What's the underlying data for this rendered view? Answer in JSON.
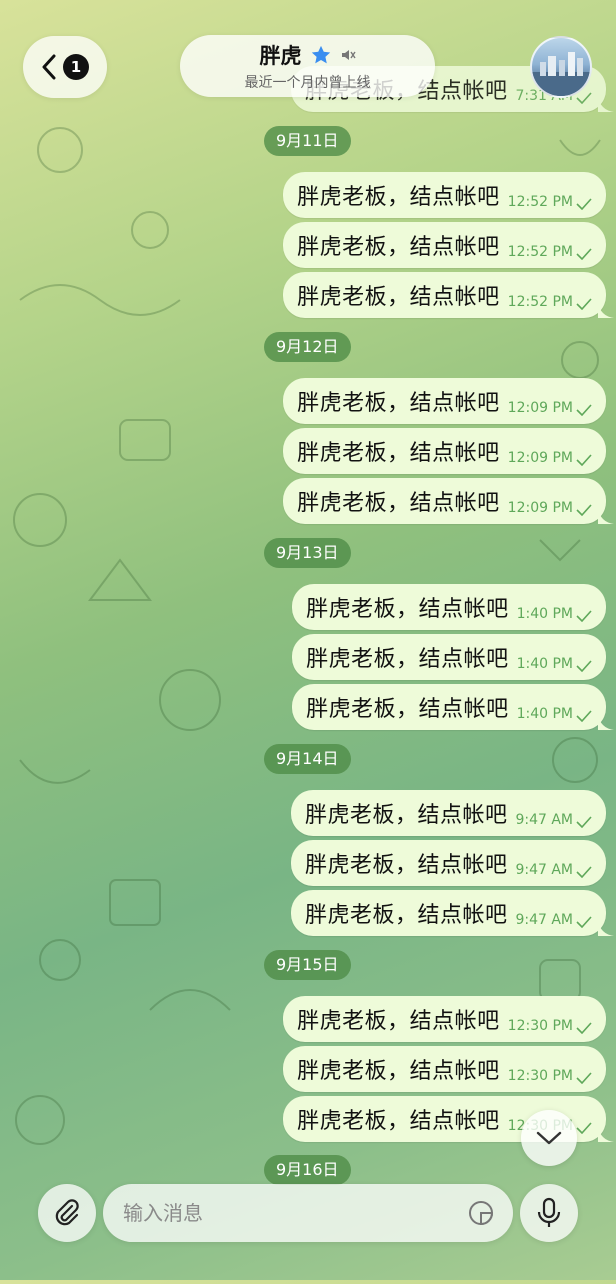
{
  "header": {
    "back_badge": "1",
    "name": "胖虎",
    "status": "最近一个月内曾上线"
  },
  "message_text": "胖虎老板，结点帐吧",
  "top_partial_time": "7:31 AM",
  "days": [
    {
      "date": "9月11日",
      "times": [
        "12:52 PM",
        "12:52 PM",
        "12:52 PM"
      ]
    },
    {
      "date": "9月12日",
      "times": [
        "12:09 PM",
        "12:09 PM",
        "12:09 PM"
      ]
    },
    {
      "date": "9月13日",
      "times": [
        "1:40 PM",
        "1:40 PM",
        "1:40 PM"
      ]
    },
    {
      "date": "9月14日",
      "times": [
        "9:47 AM",
        "9:47 AM",
        "9:47 AM"
      ]
    },
    {
      "date": "9月15日",
      "times": [
        "12:30 PM",
        "12:30 PM",
        "12:30 PM"
      ]
    },
    {
      "date": "9月16日",
      "times": []
    }
  ],
  "composer": {
    "placeholder": "输入消息"
  },
  "colors": {
    "bubble": "#eefbd9",
    "time_text": "#5fa85a",
    "date_pill": "#4e8c46",
    "star": "#3a8ef0"
  }
}
